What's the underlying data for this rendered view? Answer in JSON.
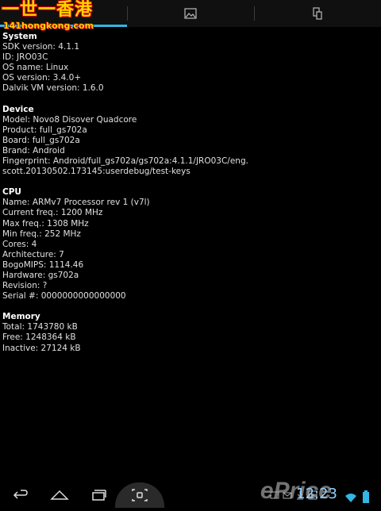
{
  "watermark": {
    "logo": "一世一香港",
    "site": "141hongkong.com",
    "brand": "ePrice"
  },
  "tabs": [
    {
      "icon": "chip-icon",
      "active": true
    },
    {
      "icon": "image-icon",
      "active": false
    },
    {
      "icon": "device-icon",
      "active": false
    }
  ],
  "sections": {
    "system": {
      "title": "System",
      "rows": [
        "SDK version: 4.1.1",
        "ID: JRO03C",
        "OS name: Linux",
        "OS version: 3.4.0+",
        "Dalvik VM version: 1.6.0"
      ]
    },
    "device": {
      "title": "Device",
      "rows": [
        "Model: Novo8 Disover Quadcore",
        "Product: full_gs702a",
        "Board: full_gs702a",
        "Brand: Android",
        "Fingerprint: Android/full_gs702a/gs702a:4.1.1/JRO03C/eng.",
        "scott.20130502.173145:userdebug/test-keys"
      ]
    },
    "cpu": {
      "title": "CPU",
      "rows": [
        "Name: ARMv7 Processor rev 1 (v7l)",
        "Current freq.: 1200 MHz",
        "Max freq.: 1308 MHz",
        "Min freq.: 252 MHz",
        "Cores: 4",
        "Architecture: 7",
        "BogoMIPS: 1114.46",
        "Hardware: gs702a",
        "Revision: ?",
        "Serial #: 0000000000000000"
      ]
    },
    "memory": {
      "title": "Memory",
      "rows": [
        "Total: 1743780 kB",
        "Free: 1248364 kB",
        "Inactive: 27124 kB"
      ]
    }
  },
  "statusbar": {
    "clock": "12:23"
  },
  "colors": {
    "accent": "#33b5e5",
    "background": "#000000",
    "clock": "#8fd0ff"
  }
}
